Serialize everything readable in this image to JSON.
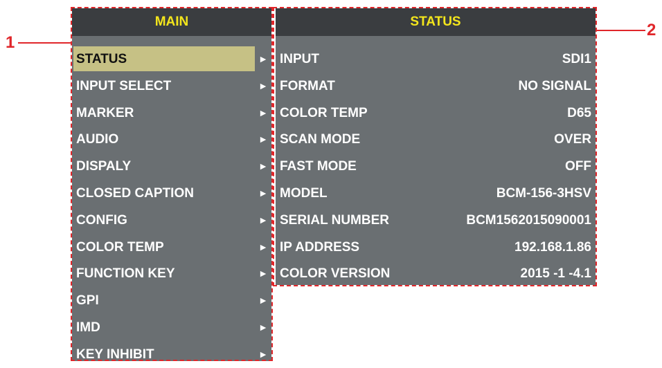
{
  "main_menu": {
    "title": "MAIN",
    "items": [
      {
        "label": "STATUS",
        "arrow": "►",
        "selected": true
      },
      {
        "label": "INPUT SELECT",
        "arrow": "►"
      },
      {
        "label": "MARKER",
        "arrow": "►"
      },
      {
        "label": "AUDIO",
        "arrow": "►"
      },
      {
        "label": "DISPALY",
        "arrow": "►"
      },
      {
        "label": "CLOSED CAPTION",
        "arrow": "►"
      },
      {
        "label": "CONFIG",
        "arrow": "►"
      },
      {
        "label": "COLOR TEMP",
        "arrow": "►"
      },
      {
        "label": "FUNCTION KEY",
        "arrow": "►"
      },
      {
        "label": "GPI",
        "arrow": "►"
      },
      {
        "label": "IMD",
        "arrow": "►"
      },
      {
        "label": "KEY INHIBIT",
        "arrow": "►"
      }
    ]
  },
  "status_panel": {
    "title": "STATUS",
    "rows": [
      {
        "key": "INPUT",
        "value": "SDI1"
      },
      {
        "key": "FORMAT",
        "value": "NO SIGNAL"
      },
      {
        "key": "COLOR TEMP",
        "value": "D65"
      },
      {
        "key": "SCAN MODE",
        "value": "OVER"
      },
      {
        "key": "FAST MODE",
        "value": "OFF"
      },
      {
        "key": "MODEL",
        "value": "BCM-156-3HSV"
      },
      {
        "key": "SERIAL NUMBER",
        "value": "BCM1562015090001"
      },
      {
        "key": "IP ADDRESS",
        "value": "192.168.1.86"
      },
      {
        "key": "COLOR VERSION",
        "value": "2015 -1 -4.1"
      }
    ]
  },
  "callouts": [
    {
      "number": "1"
    },
    {
      "number": "2"
    }
  ],
  "colors": {
    "header_bg": "#3a3d40",
    "header_text": "#f4e61c",
    "panel_bg": "#6a6f72",
    "selected_bg": "#c6c185",
    "callout_red": "#e0262a"
  }
}
